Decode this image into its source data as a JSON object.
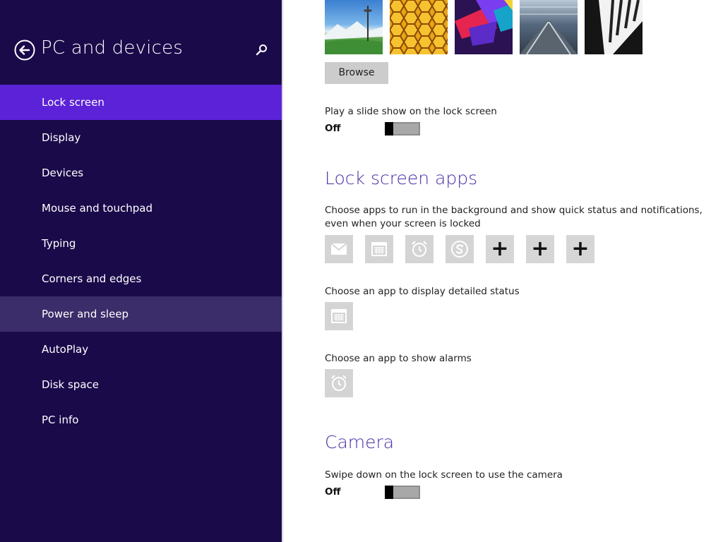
{
  "sidebar": {
    "title": "PC and devices",
    "items": [
      {
        "label": "Lock screen",
        "state": "selected"
      },
      {
        "label": "Display",
        "state": ""
      },
      {
        "label": "Devices",
        "state": ""
      },
      {
        "label": "Mouse and touchpad",
        "state": ""
      },
      {
        "label": "Typing",
        "state": ""
      },
      {
        "label": "Corners and edges",
        "state": ""
      },
      {
        "label": "Power and sleep",
        "state": "hover"
      },
      {
        "label": "AutoPlay",
        "state": ""
      },
      {
        "label": "Disk space",
        "state": ""
      },
      {
        "label": "PC info",
        "state": ""
      }
    ]
  },
  "main": {
    "browse_label": "Browse",
    "slideshow": {
      "label": "Play a slide show on the lock screen",
      "state": "Off"
    },
    "lock_apps": {
      "heading": "Lock screen apps",
      "description_line1": "Choose apps to run in the background and show quick status and notifications,",
      "description_line2": "even when your screen is locked",
      "apps": [
        "mail-icon",
        "calendar-icon",
        "alarm-icon",
        "skype-icon",
        "add-icon",
        "add-icon",
        "add-icon"
      ],
      "detailed_label": "Choose an app to display detailed status",
      "alarm_label": "Choose an app to show alarms"
    },
    "camera": {
      "heading": "Camera",
      "label": "Swipe down on the lock screen to use the camera",
      "state": "Off"
    }
  },
  "colors": {
    "sidebar_bg": "#1a0a4a",
    "selected_item": "#5b22d8",
    "hover_item": "#3b2c6a",
    "heading": "#4b2fa8"
  }
}
